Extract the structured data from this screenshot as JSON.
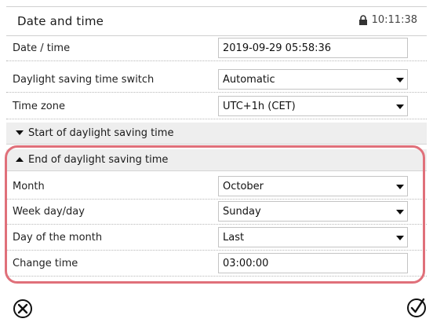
{
  "header": {
    "title": "Date and time",
    "time": "10:11:38"
  },
  "rows_top": [
    {
      "label": "Date / time",
      "value": "2019-09-29 05:58:36",
      "dropdown": false
    },
    {
      "label": "Daylight saving time switch",
      "value": "Automatic",
      "dropdown": true
    },
    {
      "label": "Time zone",
      "value": "UTC+1h (CET)",
      "dropdown": true
    }
  ],
  "sections": {
    "start": "Start of daylight saving time",
    "end": "End of daylight saving time"
  },
  "rows_end": [
    {
      "label": "Month",
      "value": "October",
      "dropdown": true
    },
    {
      "label": "Week day/day",
      "value": "Sunday",
      "dropdown": true
    },
    {
      "label": "Day of the month",
      "value": "Last",
      "dropdown": true
    },
    {
      "label": "Change time",
      "value": "03:00:00",
      "dropdown": false
    }
  ],
  "icons": {
    "cancel": "cancel-circle-x-icon",
    "confirm": "confirm-check-icon",
    "lock": "lock-icon"
  },
  "colors": {
    "highlight": "#e0707a"
  }
}
